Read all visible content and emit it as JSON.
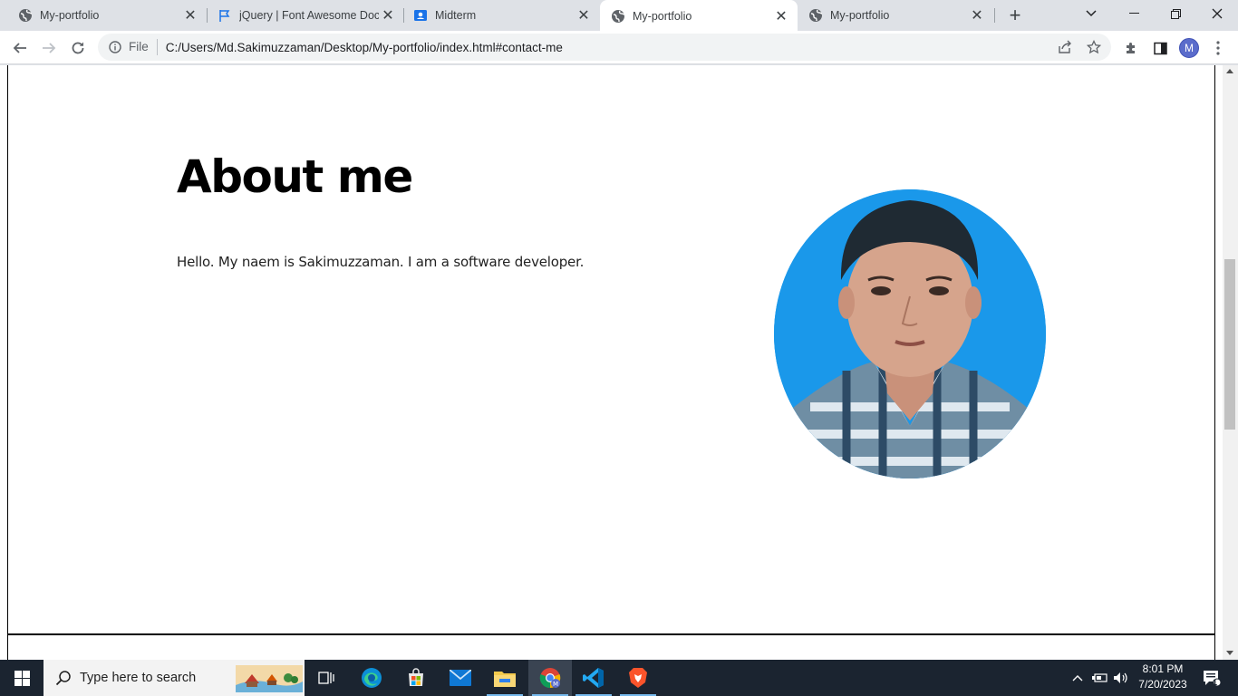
{
  "browser": {
    "tabs": [
      {
        "title": "My-portfolio",
        "icon": "globe-icon",
        "active": false
      },
      {
        "title": "jQuery | Font Awesome Docs",
        "icon": "flag-icon",
        "active": false
      },
      {
        "title": "Midterm",
        "icon": "classroom-icon",
        "active": false
      },
      {
        "title": "My-portfolio",
        "icon": "globe-icon",
        "active": true
      },
      {
        "title": "My-portfolio",
        "icon": "globe-icon",
        "active": false
      }
    ],
    "address": {
      "scheme": "File",
      "url": "C:/Users/Md.Sakimuzzaman/Desktop/My-portfolio/index.html#contact-me"
    },
    "profile_initial": "M"
  },
  "page": {
    "about_title": "About me",
    "about_text": "Hello. My naem is Sakimuzzaman. I am a software developer.",
    "photo_alt": "Profile photo"
  },
  "taskbar": {
    "search_placeholder": "Type here to search",
    "time": "8:01 PM",
    "date": "7/20/2023",
    "notification_count": "1",
    "pinned": [
      "task-view",
      "edge",
      "store",
      "mail",
      "file-explorer",
      "chrome",
      "vscode",
      "brave"
    ]
  },
  "colors": {
    "accent": "#1a73e8",
    "taskbar": "#1b2430",
    "photo_bg": "#1a98ea"
  }
}
